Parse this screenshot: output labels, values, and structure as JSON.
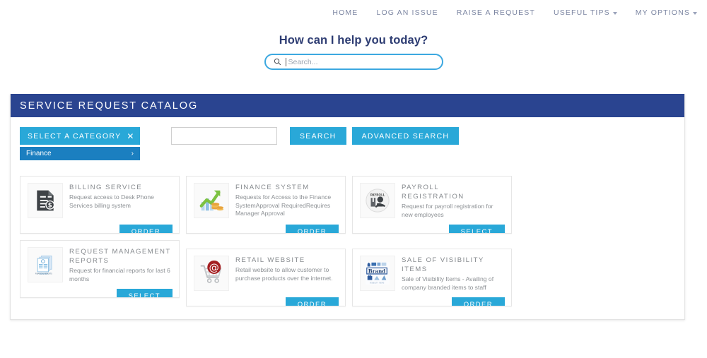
{
  "topnav": {
    "items": [
      {
        "label": "HOME",
        "has_caret": false
      },
      {
        "label": "LOG AN ISSUE",
        "has_caret": false
      },
      {
        "label": "RAISE A REQUEST",
        "has_caret": false
      },
      {
        "label": "USEFUL TIPS",
        "has_caret": true
      },
      {
        "label": "MY OPTIONS",
        "has_caret": true
      }
    ]
  },
  "hero": {
    "title": "How can I help you today?",
    "search_placeholder": "Search...",
    "search_value": "",
    "search_icon": "search-icon"
  },
  "panel": {
    "header_title": "SERVICE REQUEST CATALOG",
    "header_color": "#2a4490"
  },
  "toolbar": {
    "select_category_label": "SELECT A CATEGORY",
    "clear_icon": "✕",
    "dropdown_icon": "chevron-down-icon",
    "subcategory_label": "Finance",
    "subcategory_chevron": "›",
    "keyword_value": "",
    "keyword_placeholder": "",
    "search_label": "SEARCH",
    "advanced_search_label": "ADVANCED SEARCH",
    "accent_color": "#29a8d8",
    "subcategory_color": "#1b7fc0"
  },
  "cards": [
    {
      "title": "BILLING SERVICE",
      "desc": "Request access to Desk Phone Services billing system",
      "button": "ORDER",
      "icon": "invoice-dollar-icon"
    },
    {
      "title": "FINANCE SYSTEM",
      "desc": "Requests for Access to the Finance SystemApproval RequiredRequires Manager Approval",
      "button": "ORDER",
      "icon": "growth-chart-coins-icon"
    },
    {
      "title": "PAYROLL REGISTRATION",
      "desc": "Request for payroll registration for new employees",
      "button": "SELECT",
      "icon": "payroll-person-icon"
    },
    {
      "title": "REQUEST MANAGEMENT REPORTS",
      "desc": "Request for financial reports for last 6 months",
      "button": "SELECT",
      "icon": "financial-reports-icon"
    },
    {
      "title": "RETAIL WEBSITE",
      "desc": "Retail website to allow customer to purchase products over the internet.",
      "button": "ORDER",
      "icon": "shopping-cart-at-icon"
    },
    {
      "title": "SALE OF VISIBILITY ITEMS",
      "desc": "Sale of Visibility Items - Availing of company branded items to staff through purchasing of stock from the communications division",
      "button": "ORDER",
      "icon": "brand-items-icon"
    }
  ]
}
